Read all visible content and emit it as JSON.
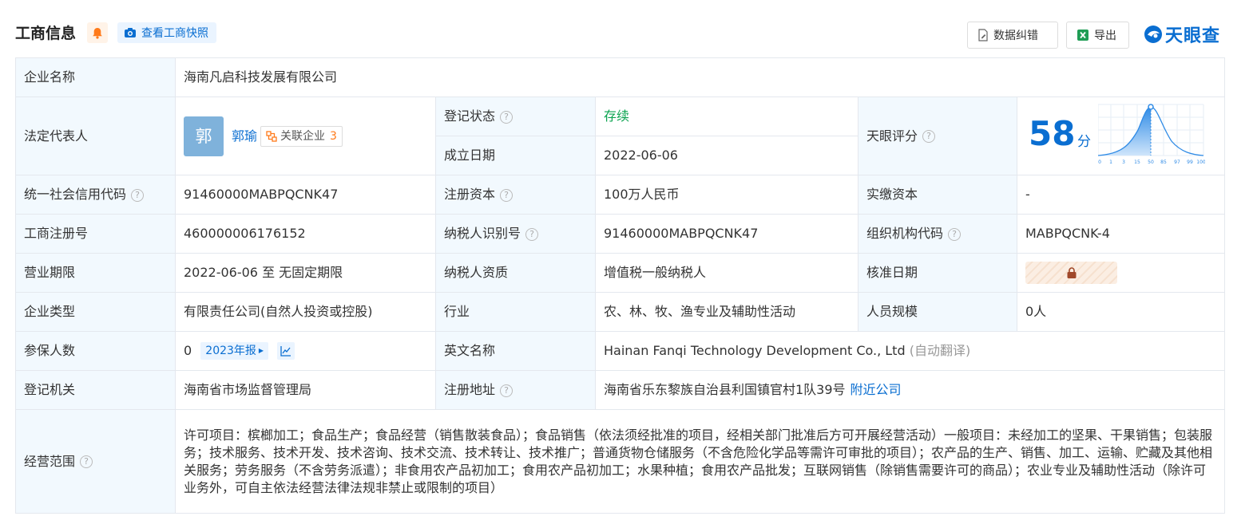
{
  "header": {
    "title": "工商信息",
    "snapshot_label": "查看工商快照",
    "correct_label": "数据纠错",
    "export_label": "导出",
    "logo_text": "天眼查"
  },
  "colors": {
    "accent": "#0a6ed1",
    "label_bg": "#f2f9fe",
    "status_green": "#0aa34f",
    "badge_orange": "#ff7a1a"
  },
  "rows": {
    "company_name": {
      "label": "企业名称",
      "value": "海南凡启科技发展有限公司"
    },
    "legal_rep": {
      "label": "法定代表人",
      "avatar_char": "郭",
      "name": "郭瑜",
      "related_label": "关联企业",
      "related_count": "3"
    },
    "reg_status": {
      "label": "登记状态",
      "value": "存续"
    },
    "found_date": {
      "label": "成立日期",
      "value": "2022-06-06"
    },
    "tianyan_score": {
      "label": "天眼评分",
      "value": "58",
      "unit": "分",
      "axis_ticks": [
        "0",
        "1",
        "3",
        "15",
        "50",
        "85",
        "97",
        "99",
        "100"
      ]
    },
    "credit_code": {
      "label": "统一社会信用代码",
      "value": "91460000MABPQCNK47"
    },
    "reg_capital": {
      "label": "注册资本",
      "value": "100万人民币"
    },
    "paid_capital": {
      "label": "实缴资本",
      "value": "-"
    },
    "reg_number": {
      "label": "工商注册号",
      "value": "460000006176152"
    },
    "taxpayer_id": {
      "label": "纳税人识别号",
      "value": "91460000MABPQCNK47"
    },
    "org_code": {
      "label": "组织机构代码",
      "value": "MABPQCNK-4"
    },
    "biz_term": {
      "label": "营业期限",
      "value": "2022-06-06 至 无固定期限"
    },
    "taxpayer_qual": {
      "label": "纳税人资质",
      "value": "增值税一般纳税人"
    },
    "approve_date": {
      "label": "核准日期"
    },
    "company_type": {
      "label": "企业类型",
      "value": "有限责任公司(自然人投资或控股)"
    },
    "industry": {
      "label": "行业",
      "value": "农、林、牧、渔专业及辅助性活动"
    },
    "staff_size": {
      "label": "人员规模",
      "value": "0人"
    },
    "insured": {
      "label": "参保人数",
      "value": "0",
      "year_tag": "2023年报"
    },
    "english_name": {
      "label": "英文名称",
      "value": "Hainan Fanqi Technology Development Co., Ltd",
      "note": "(自动翻译)"
    },
    "reg_authority": {
      "label": "登记机关",
      "value": "海南省市场监督管理局"
    },
    "reg_address": {
      "label": "注册地址",
      "value": "海南省乐东黎族自治县利国镇官村1队39号",
      "nearby_link": "附近公司"
    },
    "scope": {
      "label": "经营范围",
      "value": "许可项目：槟榔加工；食品生产；食品经营（销售散装食品）；食品销售（依法须经批准的项目，经相关部门批准后方可开展经营活动）一般项目：未经加工的坚果、干果销售；包装服务；技术服务、技术开发、技术咨询、技术交流、技术转让、技术推广；普通货物仓储服务（不含危险化学品等需许可审批的项目）；农产品的生产、销售、加工、运输、贮藏及其他相关服务；劳务服务（不含劳务派遣）；非食用农产品初加工；食用农产品初加工；水果种植；食用农产品批发；互联网销售（除销售需要许可的商品）；农业专业及辅助性活动（除许可业务外，可自主依法经营法律法规非禁止或限制的项目）"
    }
  }
}
